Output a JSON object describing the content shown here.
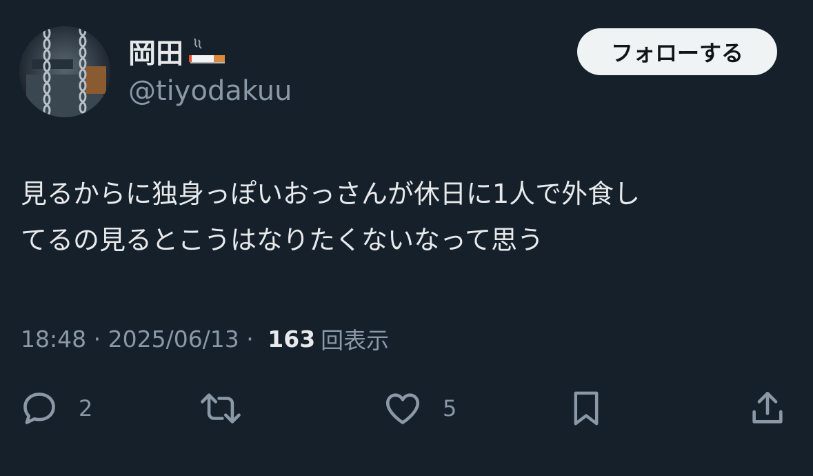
{
  "user": {
    "display_name": "岡田",
    "handle": "@tiyodakuu"
  },
  "follow_button_label": "フォローする",
  "tweet": {
    "text": "見るからに独身っぽいおっさんが休日に1人で外食し\nてるの見るとこうはなりたくないなって思う"
  },
  "meta": {
    "time": "18:48",
    "separator": " · ",
    "date": "2025/06/13",
    "views_count": "163",
    "views_label": "回表示"
  },
  "actions": {
    "reply": {
      "icon": "reply-bubble-icon",
      "count": "2"
    },
    "retweet": {
      "icon": "retweet-icon",
      "count": ""
    },
    "like": {
      "icon": "heart-icon",
      "count": "5"
    },
    "bookmark": {
      "icon": "bookmark-icon"
    },
    "share": {
      "icon": "share-icon"
    }
  },
  "colors": {
    "background": "#15202b",
    "primary_text": "#e7e9ea",
    "secondary_text": "#8b98a5",
    "button_bg": "#eff3f4",
    "button_text": "#0f1419"
  }
}
